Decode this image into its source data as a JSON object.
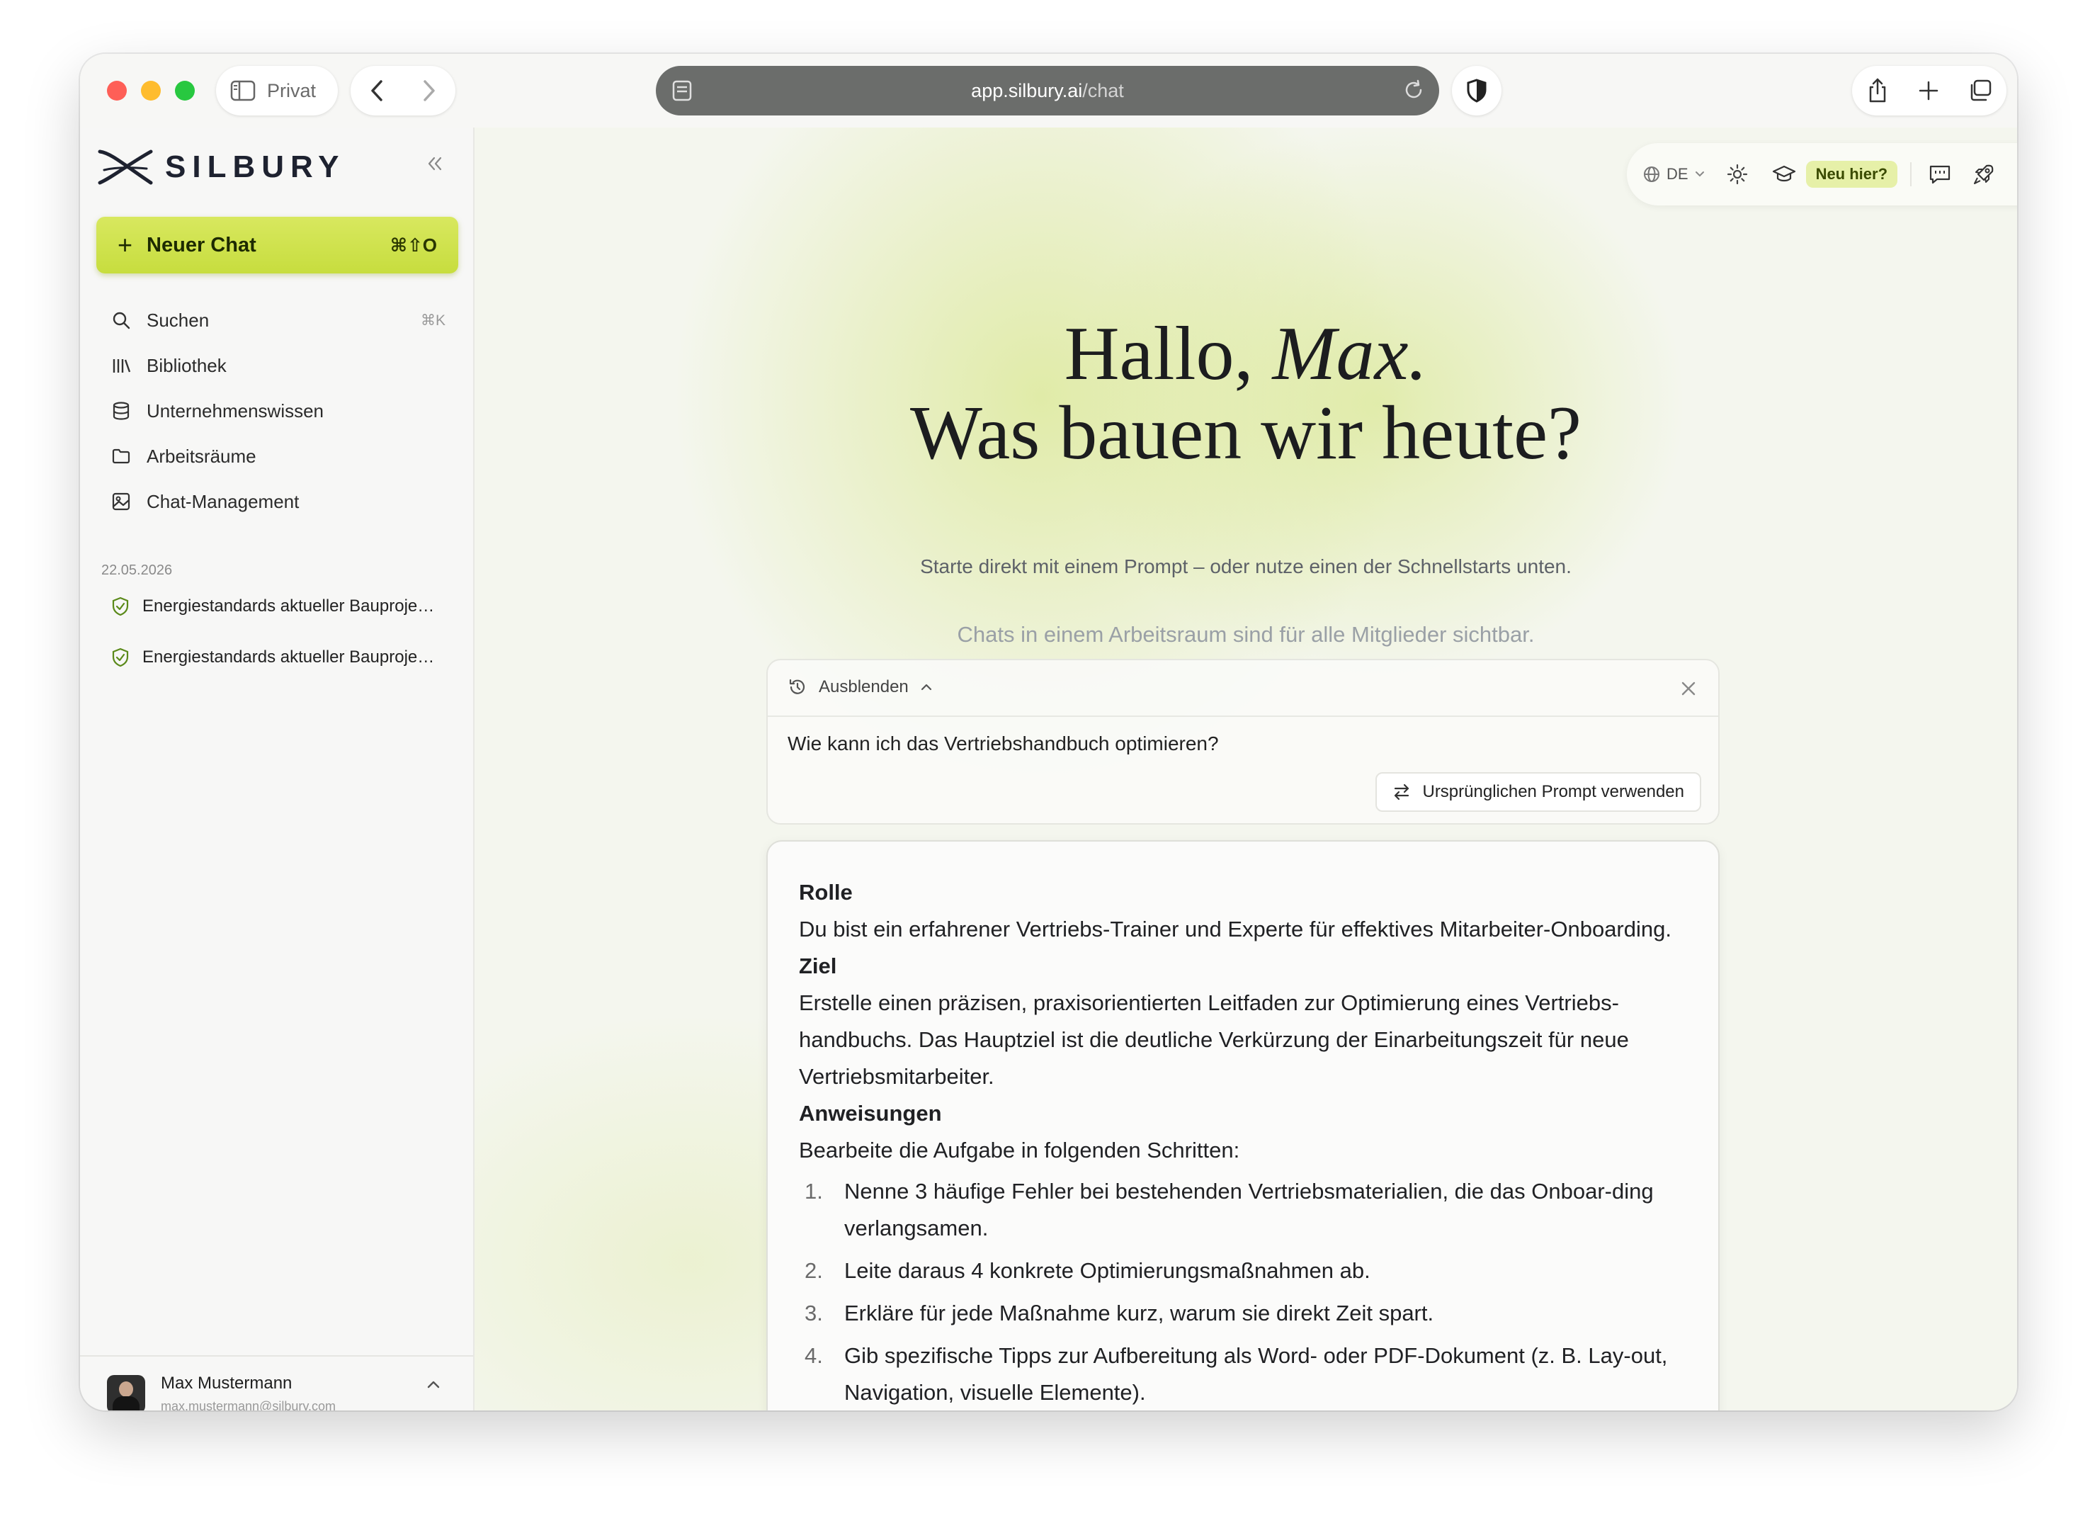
{
  "browser": {
    "private_label": "Privat",
    "url_host": "app.silbury.ai",
    "url_path": "/chat"
  },
  "sidebar": {
    "brand": "SILBURY",
    "new_chat": {
      "label": "Neuer Chat",
      "shortcut": "⌘⇧O"
    },
    "nav": [
      {
        "label": "Suchen",
        "shortcut": "⌘K",
        "icon": "search-icon"
      },
      {
        "label": "Bibliothek",
        "shortcut": "",
        "icon": "library-icon"
      },
      {
        "label": "Unternehmenswissen",
        "shortcut": "",
        "icon": "database-icon"
      },
      {
        "label": "Arbeitsräume",
        "shortcut": "",
        "icon": "folder-icon"
      },
      {
        "label": "Chat-Management",
        "shortcut": "",
        "icon": "image-icon"
      }
    ],
    "history_date": "22.05.2026",
    "history": [
      {
        "title": "Energiestandards aktueller Bauprojekte"
      },
      {
        "title": "Energiestandards aktueller Bauprojekte"
      }
    ],
    "user": {
      "name": "Max Mustermann",
      "email": "max.mustermann@silbury.com"
    }
  },
  "toolbar": {
    "language": "DE",
    "new_here": "Neu hier?"
  },
  "hero": {
    "greeting_prefix": "Hallo, ",
    "greeting_name": "Max.",
    "headline": "Was bauen wir heute?",
    "subtitle": "Starte direkt mit einem Prompt – oder nutze einen der Schnellstarts unten.",
    "workspace_note": "Chats in einem Arbeitsraum sind für alle Mitglieder sichtbar."
  },
  "prompt_panel": {
    "hide_label": "Ausblenden",
    "original_prompt": "Wie kann ich das Vertriebshandbuch optimieren?",
    "use_original_button": "Ursprünglichen Prompt verwenden"
  },
  "optimized_prompt": {
    "role_heading": "Rolle",
    "role_text": "Du bist ein erfahrener Vertriebs-Trainer und Experte für effektives Mitarbeiter-Onboarding.",
    "goal_heading": "Ziel",
    "goal_text": "Erstelle einen präzisen, praxisorientierten Leitfaden zur Optimierung eines Vertriebs-handbuchs. Das Hauptziel ist die deutliche Verkürzung der Einarbeitungszeit für neue Vertriebsmitarbeiter.",
    "instructions_heading": "Anweisungen",
    "instructions_intro": "Bearbeite die Aufgabe in folgenden Schritten:",
    "steps": [
      {
        "num": "1.",
        "text": "Nenne 3 häufige Fehler bei bestehenden Vertriebsmaterialien, die das Onboar-ding verlangsamen."
      },
      {
        "num": "2.",
        "text": "Leite daraus 4 konkrete Optimierungsmaßnahmen ab."
      },
      {
        "num": "3.",
        "text": "Erkläre für jede Maßnahme kurz, warum sie direkt Zeit spart."
      },
      {
        "num": "4.",
        "text": "Gib spezifische Tipps zur Aufbereitung als Word- oder PDF-Dokument (z. B. Lay-out, Navigation, visuelle Elemente)."
      }
    ]
  }
}
